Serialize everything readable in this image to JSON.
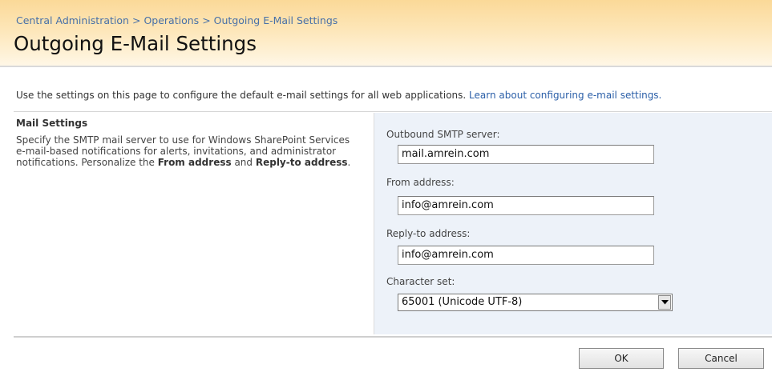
{
  "breadcrumb": {
    "items": [
      "Central Administration",
      "Operations",
      "Outgoing E-Mail Settings"
    ],
    "separator": ">"
  },
  "page": {
    "title": "Outgoing E-Mail Settings",
    "description": "Use the settings on this page to configure the default e-mail settings for all web applications.",
    "learn_link": "Learn about configuring e-mail settings."
  },
  "section": {
    "title": "Mail Settings",
    "desc_part1": "Specify the SMTP mail server to use for Windows SharePoint Services e-mail-based notifications for alerts, invitations, and administrator notifications.  Personalize the ",
    "desc_bold1": "From address",
    "desc_part2": " and ",
    "desc_bold2": "Reply-to address",
    "desc_part3": "."
  },
  "form": {
    "smtp_label": "Outbound SMTP server:",
    "smtp_value": "mail.amrein.com",
    "from_label": "From address:",
    "from_value": "info@amrein.com",
    "reply_label": "Reply-to address:",
    "reply_value": "info@amrein.com",
    "charset_label": "Character set:",
    "charset_value": "65001 (Unicode UTF-8)"
  },
  "buttons": {
    "ok": "OK",
    "cancel": "Cancel"
  },
  "colors": {
    "link": "#4770a8",
    "title_band": "#fbd998",
    "form_panel": "#edf2f9"
  },
  "icons": {
    "dropdown": "chevron-down-icon"
  }
}
